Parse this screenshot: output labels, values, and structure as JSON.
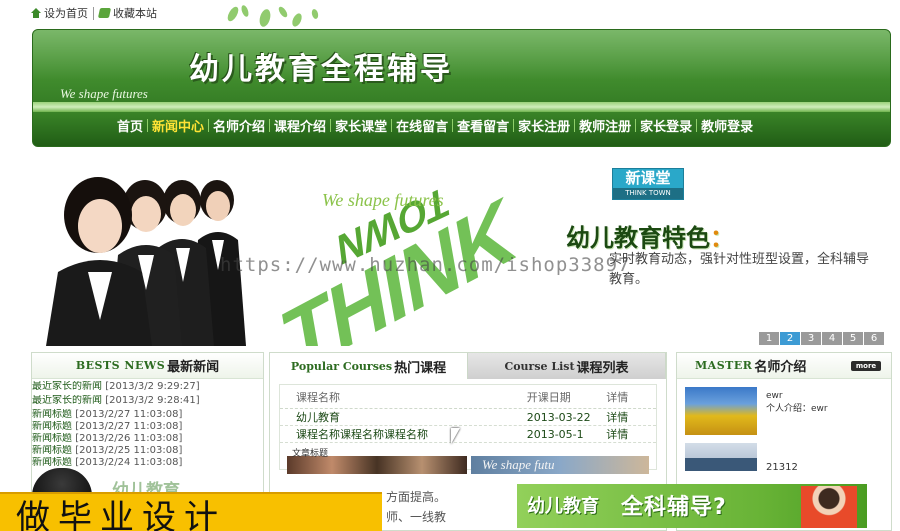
{
  "top_links": {
    "home": "设为首页",
    "favorite": "收藏本站"
  },
  "header": {
    "site_title": "幼儿教育全程辅导",
    "slogan": "We shape futures",
    "nav": [
      {
        "label": "首页",
        "active": false
      },
      {
        "label": "新闻中心",
        "active": true
      },
      {
        "label": "名师介绍",
        "active": false
      },
      {
        "label": "课程介绍",
        "active": false
      },
      {
        "label": "家长课堂",
        "active": false
      },
      {
        "label": "在线留言",
        "active": false
      },
      {
        "label": "查看留言",
        "active": false
      },
      {
        "label": "家长注册",
        "active": false
      },
      {
        "label": "教师注册",
        "active": false
      },
      {
        "label": "家长登录",
        "active": false
      },
      {
        "label": "教师登录",
        "active": false
      }
    ]
  },
  "banner": {
    "subtitle": "We shape futures",
    "big_word": "THINK",
    "town_word": "TOWN",
    "logo_cn": "新课堂",
    "logo_en": "THINK TOWN",
    "feature_title": "幼儿教育特色",
    "feature_colon": "：",
    "feature_text": "实时教育动态，强针对性班型设置，全科辅导教育。",
    "slides": [
      "1",
      "2",
      "3",
      "4",
      "5",
      "6"
    ],
    "active_slide": "2",
    "watermark": "https://www.huzhan.com/ishop33897"
  },
  "news": {
    "title_en": "BESTS NEWS",
    "title_cn": "最新新闻",
    "items": [
      {
        "title": "最近家长的新闻",
        "date": "[2013/3/2 9:29:27]"
      },
      {
        "title": "最近家长的新闻",
        "date": "[2013/3/2 9:28:41]"
      },
      {
        "title": "新闻标题",
        "date": "[2013/2/27 11:03:08]"
      },
      {
        "title": "新闻标题",
        "date": "[2013/2/27 11:03:08]"
      },
      {
        "title": "新闻标题",
        "date": "[2013/2/26 11:03:08]"
      },
      {
        "title": "新闻标题",
        "date": "[2013/2/25 11:03:08]"
      },
      {
        "title": "新闻标题",
        "date": "[2013/2/24 11:03:08]"
      }
    ]
  },
  "courses": {
    "tab_popular_en": "Popular Courses",
    "tab_popular_cn": "热门课程",
    "tab_list_en": "Course List",
    "tab_list_cn": "课程列表",
    "col_name": "课程名称",
    "col_date": "开课日期",
    "col_detail": "详情",
    "rows": [
      {
        "name": "幼儿教育",
        "date": "2013-03-22",
        "detail": "详情"
      },
      {
        "name": "课程名称课程名称课程名称",
        "date": "2013-05-1",
        "detail": "详情"
      }
    ],
    "thumb_caption": "文章标题",
    "thumb2_caption": "We shape futu"
  },
  "master": {
    "title_en": "MASTER",
    "title_cn": "名师介绍",
    "more": "more",
    "teachers": [
      {
        "name": "ewr",
        "intro": "个人介绍：ewr"
      },
      {
        "name": "21312"
      }
    ]
  },
  "overlays": {
    "yellow_text": "做毕业设计",
    "faint_right_1": "方面提高。",
    "faint_right_2": "师、一线教",
    "faint_left": "幼儿教育",
    "ad_part1": "幼儿教育",
    "ad_part2": "全科辅导?"
  }
}
